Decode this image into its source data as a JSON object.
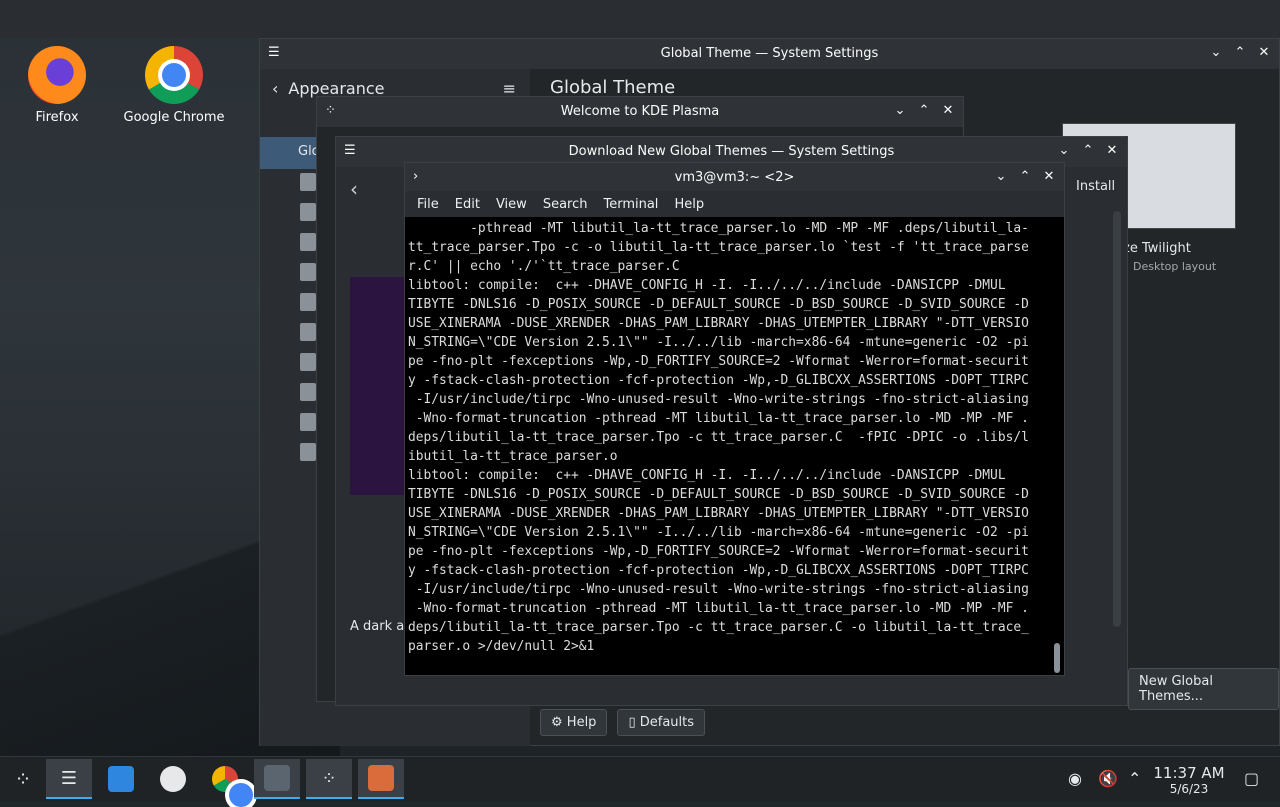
{
  "desktop": {
    "icons": [
      {
        "label": "Firefox"
      },
      {
        "label": "Google Chrome"
      }
    ]
  },
  "system_settings": {
    "title": "Global Theme — System Settings",
    "back_label": "Appearance",
    "page_title": "Global Theme",
    "sidebar_selected": "Glo",
    "theme_name": "ze Twilight",
    "theme_sub": "Desktop layout",
    "get_new_label": "New Global Themes...",
    "help_label": "Help",
    "defaults_label": "Defaults"
  },
  "welcome": {
    "title": "Welcome to KDE Plasma"
  },
  "download": {
    "title": "Download New Global Themes — System Settings",
    "install_label": "Install",
    "desc": "A dark ar"
  },
  "terminal": {
    "title": "vm3@vm3:~ <2>",
    "menu": [
      "File",
      "Edit",
      "View",
      "Search",
      "Terminal",
      "Help"
    ],
    "output": "        -pthread -MT libutil_la-tt_trace_parser.lo -MD -MP -MF .deps/libutil_la-\ntt_trace_parser.Tpo -c -o libutil_la-tt_trace_parser.lo `test -f 'tt_trace_parse\nr.C' || echo './'`tt_trace_parser.C\nlibtool: compile:  c++ -DHAVE_CONFIG_H -I. -I../../../include -DANSICPP -DMUL\nTIBYTE -DNLS16 -D_POSIX_SOURCE -D_DEFAULT_SOURCE -D_BSD_SOURCE -D_SVID_SOURCE -D\nUSE_XINERAMA -DUSE_XRENDER -DHAS_PAM_LIBRARY -DHAS_UTEMPTER_LIBRARY \"-DTT_VERSIO\nN_STRING=\\\"CDE Version 2.5.1\\\"\" -I../../lib -march=x86-64 -mtune=generic -O2 -pi\npe -fno-plt -fexceptions -Wp,-D_FORTIFY_SOURCE=2 -Wformat -Werror=format-securit\ny -fstack-clash-protection -fcf-protection -Wp,-D_GLIBCXX_ASSERTIONS -DOPT_TIRPC\n -I/usr/include/tirpc -Wno-unused-result -Wno-write-strings -fno-strict-aliasing\n -Wno-format-truncation -pthread -MT libutil_la-tt_trace_parser.lo -MD -MP -MF .\ndeps/libutil_la-tt_trace_parser.Tpo -c tt_trace_parser.C  -fPIC -DPIC -o .libs/l\nibutil_la-tt_trace_parser.o\nlibtool: compile:  c++ -DHAVE_CONFIG_H -I. -I../../../include -DANSICPP -DMUL\nTIBYTE -DNLS16 -D_POSIX_SOURCE -D_DEFAULT_SOURCE -D_BSD_SOURCE -D_SVID_SOURCE -D\nUSE_XINERAMA -DUSE_XRENDER -DHAS_PAM_LIBRARY -DHAS_UTEMPTER_LIBRARY \"-DTT_VERSIO\nN_STRING=\\\"CDE Version 2.5.1\\\"\" -I../../lib -march=x86-64 -mtune=generic -O2 -pi\npe -fno-plt -fexceptions -Wp,-D_FORTIFY_SOURCE=2 -Wformat -Werror=format-securit\ny -fstack-clash-protection -fcf-protection -Wp,-D_GLIBCXX_ASSERTIONS -DOPT_TIRPC\n -I/usr/include/tirpc -Wno-unused-result -Wno-write-strings -fno-strict-aliasing\n -Wno-format-truncation -pthread -MT libutil_la-tt_trace_parser.lo -MD -MP -MF .\ndeps/libutil_la-tt_trace_parser.Tpo -c tt_trace_parser.C -o libutil_la-tt_trace_\nparser.o >/dev/null 2>&1"
  },
  "taskbar": {
    "time": "11:37 AM",
    "date": "5/6/23"
  },
  "colors": {
    "accent": "#3daee9",
    "terminal_bg": "#000000"
  }
}
